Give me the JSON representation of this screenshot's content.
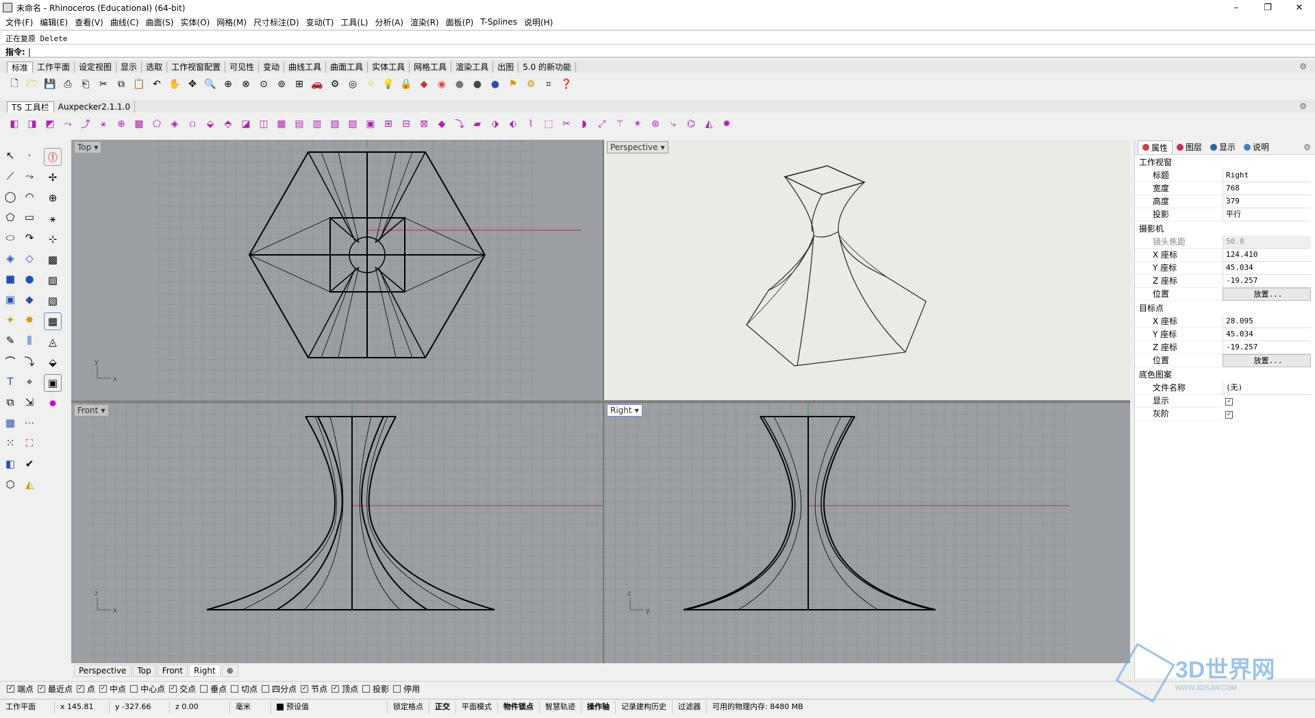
{
  "window": {
    "title": "未命名 - Rhinoceros (Educational) (64-bit)",
    "min": "–",
    "max": "❐",
    "close": "✕"
  },
  "menu": [
    "文件(F)",
    "编辑(E)",
    "查看(V)",
    "曲线(C)",
    "曲面(S)",
    "实体(O)",
    "网格(M)",
    "尺寸标注(D)",
    "变动(T)",
    "工具(L)",
    "分析(A)",
    "渲染(R)",
    "面板(P)",
    "T-Splines",
    "说明(H)"
  ],
  "command": {
    "history": "正在复原 Delete",
    "prompt": "指令:",
    "value": ""
  },
  "toolbar_tabs_1": [
    "标准",
    "工作平面",
    "设定视图",
    "显示",
    "选取",
    "工作视窗配置",
    "可见性",
    "变动",
    "曲线工具",
    "曲面工具",
    "实体工具",
    "网格工具",
    "渲染工具",
    "出图",
    "5.0 的新功能"
  ],
  "toolbar_tabs_2": [
    "TS 工具栏",
    "Auxpecker2.1.1.0"
  ],
  "viewports": {
    "top": {
      "label": "Top"
    },
    "perspective": {
      "label": "Perspective"
    },
    "front": {
      "label": "Front"
    },
    "right": {
      "label": "Right"
    }
  },
  "axis": {
    "x": "x",
    "y": "y",
    "z": "z"
  },
  "viewport_tabs": [
    "Perspective",
    "Top",
    "Front",
    "Right"
  ],
  "panel": {
    "tabs": [
      "属性",
      "图层",
      "显示",
      "说明"
    ],
    "tab_colors": [
      "#d04040",
      "#c03060",
      "#3060a0",
      "#4080c0"
    ],
    "sections": {
      "viewport": "工作视窗",
      "camera": "摄影机",
      "target": "目标点",
      "wallpaper": "底色图案"
    },
    "viewport_props": [
      {
        "k": "标题",
        "v": "Right"
      },
      {
        "k": "宽度",
        "v": "768"
      },
      {
        "k": "高度",
        "v": "379"
      },
      {
        "k": "投影",
        "v": "平行"
      }
    ],
    "camera_props": [
      {
        "k": "镜头焦距",
        "v": "50.0"
      },
      {
        "k": "X 座标",
        "v": "124.410"
      },
      {
        "k": "Y 座标",
        "v": "45.034"
      },
      {
        "k": "Z 座标",
        "v": "-19.257"
      },
      {
        "k": "位置",
        "v": "放置..."
      }
    ],
    "target_props": [
      {
        "k": "X 座标",
        "v": "28.095"
      },
      {
        "k": "Y 座标",
        "v": "45.034"
      },
      {
        "k": "Z 座标",
        "v": "-19.257"
      },
      {
        "k": "位置",
        "v": "放置..."
      }
    ],
    "wallpaper_props": [
      {
        "k": "文件名称",
        "v": "(无)"
      },
      {
        "k": "显示",
        "v": "✓"
      },
      {
        "k": "灰阶",
        "v": "✓"
      }
    ]
  },
  "osnaps": [
    {
      "label": "端点",
      "checked": true
    },
    {
      "label": "最近点",
      "checked": true
    },
    {
      "label": "点",
      "checked": true
    },
    {
      "label": "中点",
      "checked": true
    },
    {
      "label": "中心点",
      "checked": false
    },
    {
      "label": "交点",
      "checked": true
    },
    {
      "label": "垂点",
      "checked": false
    },
    {
      "label": "切点",
      "checked": false
    },
    {
      "label": "四分点",
      "checked": false
    },
    {
      "label": "节点",
      "checked": true
    },
    {
      "label": "顶点",
      "checked": true
    },
    {
      "label": "投影",
      "checked": false
    },
    {
      "label": "停用",
      "checked": false
    }
  ],
  "status": {
    "cplane": "工作平面",
    "x": "x 145.81",
    "y": "y -327.66",
    "z": "z 0.00",
    "units": "毫米",
    "layer": "预设值",
    "grid_snap": "锁定格点",
    "ortho": "正交",
    "planar": "平面模式",
    "osnap": "物件锁点",
    "smarttrack": "智慧轨迹",
    "gumball": "操作轴",
    "history": "记录建构历史",
    "filter": "过滤器",
    "memory": "可用的物理内存: 8480 MB"
  },
  "watermark": {
    "text": "3D世界网",
    "url": "WWW.3DSJW.COM"
  },
  "colors": {
    "viewport_bg": "#9b9fa4",
    "grid": "#8a8e93",
    "x_axis": "#b03030",
    "y_axis": "#30a030",
    "perspective_bg": "#ebebe6"
  }
}
